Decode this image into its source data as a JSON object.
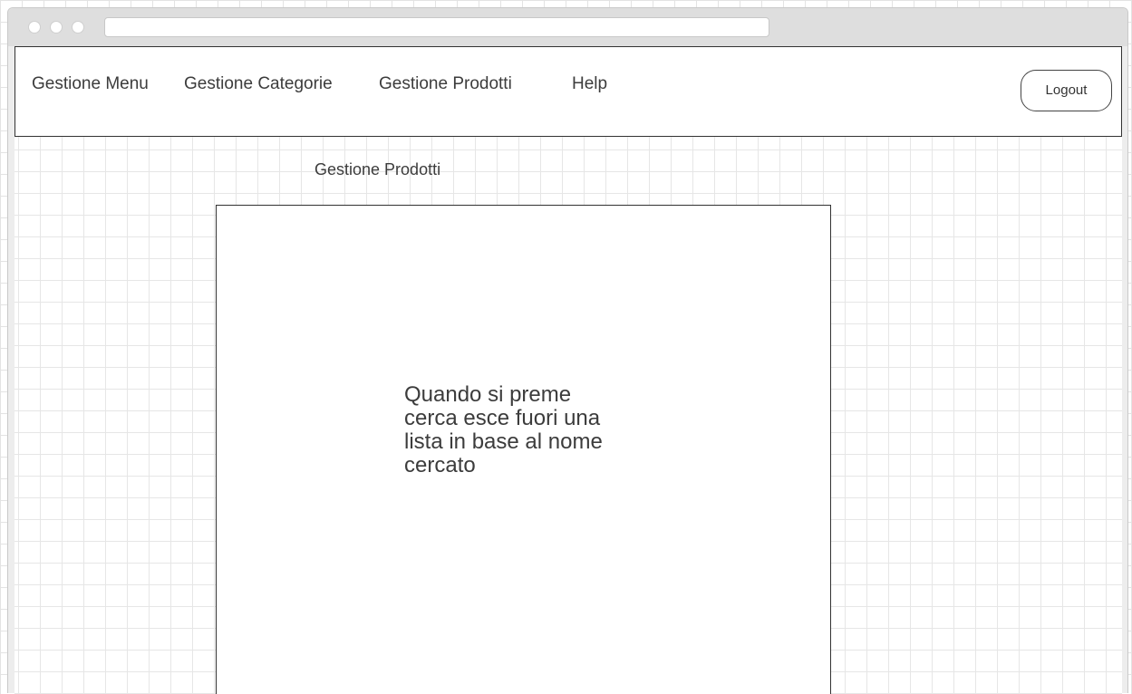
{
  "nav": {
    "items": [
      {
        "label": "Gestione Menu"
      },
      {
        "label": "Gestione Categorie"
      },
      {
        "label": "Gestione Prodotti"
      },
      {
        "label": "Help"
      }
    ],
    "logout_label": "Logout"
  },
  "page": {
    "title": "Gestione Prodotti"
  },
  "panel": {
    "note": "Quando si preme\ncerca esce fuori una\nlista in base al nome\ncercato"
  }
}
